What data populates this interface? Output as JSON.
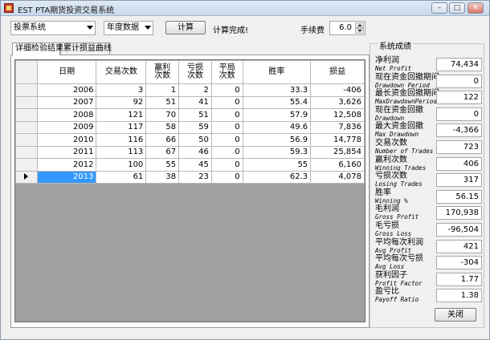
{
  "window": {
    "title": "EST PTA期货投资交易系统",
    "min_glyph": "–",
    "max_glyph": "□",
    "close_glyph": "✕"
  },
  "toolbar": {
    "strategy_select_value": "投票系统",
    "period_select_value": "年度数据",
    "calc_button_label": "计算",
    "status_text": "计算完成!",
    "fee_label": "手续费",
    "fee_value": "6.0"
  },
  "tabs": [
    {
      "label": "详细检验结果",
      "active": true
    },
    {
      "label": "累计损益曲线",
      "active": false
    }
  ],
  "table": {
    "headers": [
      "日期",
      "交易次数",
      "赢利\n次数",
      "亏损\n次数",
      "平局\n次数",
      "胜率",
      "损益"
    ],
    "rows": [
      [
        "2006",
        "3",
        "1",
        "2",
        "0",
        "33.3",
        "-406"
      ],
      [
        "2007",
        "92",
        "51",
        "41",
        "0",
        "55.4",
        "3,626"
      ],
      [
        "2008",
        "121",
        "70",
        "51",
        "0",
        "57.9",
        "12,508"
      ],
      [
        "2009",
        "117",
        "58",
        "59",
        "0",
        "49.6",
        "7,836"
      ],
      [
        "2010",
        "116",
        "66",
        "50",
        "0",
        "56.9",
        "14,778"
      ],
      [
        "2011",
        "113",
        "67",
        "46",
        "0",
        "59.3",
        "25,854"
      ],
      [
        "2012",
        "100",
        "55",
        "45",
        "0",
        "55",
        "6,160"
      ],
      [
        "2013",
        "61",
        "38",
        "23",
        "0",
        "62.3",
        "4,078"
      ]
    ],
    "selected_row_index": 7
  },
  "stats": {
    "title": "系统成绩",
    "items": [
      {
        "zh": "净利润",
        "en": "Net Profit",
        "value": "74,434"
      },
      {
        "zh": "现在资金回撤期间",
        "en": "Drawdown Period",
        "value": "0"
      },
      {
        "zh": "最长资金回撤期间",
        "en": "MaxDrawdownPeriod",
        "value": "122"
      },
      {
        "zh": "现在资金回撤",
        "en": "Drawdown",
        "value": "0"
      },
      {
        "zh": "最大资金回撤",
        "en": "Max Drawdown",
        "value": "-4,366"
      },
      {
        "zh": "交易次数",
        "en": "Number of Trades",
        "value": "723"
      },
      {
        "zh": "赢利次数",
        "en": "Winning Trades",
        "value": "406"
      },
      {
        "zh": "亏损次数",
        "en": "Losing Trades",
        "value": "317"
      },
      {
        "zh": "胜率",
        "en": "Winning %",
        "value": "56.15"
      },
      {
        "zh": "毛利润",
        "en": "Gross Profit",
        "value": "170,938"
      },
      {
        "zh": "毛亏损",
        "en": "Gross Loss",
        "value": "-96,504"
      },
      {
        "zh": "平均每次利润",
        "en": "Avg Profit",
        "value": "421"
      },
      {
        "zh": "平均每次亏损",
        "en": "Avg Loss",
        "value": "-304"
      },
      {
        "zh": "获利因子",
        "en": "Profit Factor",
        "value": "1.77"
      },
      {
        "zh": "盈亏比",
        "en": "Payoff Ratio",
        "value": "1.38"
      }
    ],
    "close_button_label": "关闭"
  }
}
